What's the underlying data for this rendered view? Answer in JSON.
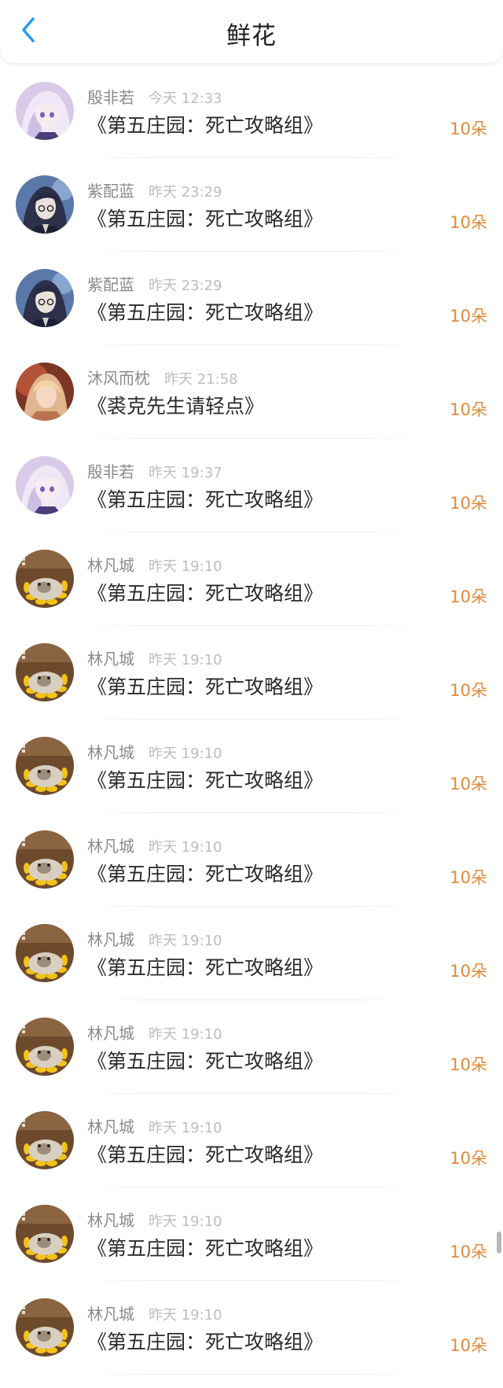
{
  "header": {
    "title": "鲜花"
  },
  "icons": {
    "back": "chevron-left-icon"
  },
  "colors": {
    "accent": "#2a9df4",
    "amount": "#e08a3a"
  },
  "items": [
    {
      "name": "殷非若",
      "time": "今天 12:33",
      "book": "《第五庄园：死亡攻略组》",
      "amount": "10朵",
      "avatar": "anime-girl-lavender"
    },
    {
      "name": "紫配蓝",
      "time": "昨天 23:29",
      "book": "《第五庄园：死亡攻略组》",
      "amount": "10朵",
      "avatar": "anime-boy-dark"
    },
    {
      "name": "紫配蓝",
      "time": "昨天 23:29",
      "book": "《第五庄园：死亡攻略组》",
      "amount": "10朵",
      "avatar": "anime-boy-dark"
    },
    {
      "name": "沐风而枕",
      "time": "昨天 21:58",
      "book": "《裘克先生请轻点》",
      "amount": "10朵",
      "avatar": "anime-warm"
    },
    {
      "name": "殷非若",
      "time": "昨天 19:37",
      "book": "《第五庄园：死亡攻略组》",
      "amount": "10朵",
      "avatar": "anime-girl-lavender"
    },
    {
      "name": "林凡城",
      "time": "昨天 19:10",
      "book": "《第五庄园：死亡攻略组》",
      "amount": "10朵",
      "avatar": "cat-sunflower"
    },
    {
      "name": "林凡城",
      "time": "昨天 19:10",
      "book": "《第五庄园：死亡攻略组》",
      "amount": "10朵",
      "avatar": "cat-sunflower"
    },
    {
      "name": "林凡城",
      "time": "昨天 19:10",
      "book": "《第五庄园：死亡攻略组》",
      "amount": "10朵",
      "avatar": "cat-sunflower"
    },
    {
      "name": "林凡城",
      "time": "昨天 19:10",
      "book": "《第五庄园：死亡攻略组》",
      "amount": "10朵",
      "avatar": "cat-sunflower"
    },
    {
      "name": "林凡城",
      "time": "昨天 19:10",
      "book": "《第五庄园：死亡攻略组》",
      "amount": "10朵",
      "avatar": "cat-sunflower"
    },
    {
      "name": "林凡城",
      "time": "昨天 19:10",
      "book": "《第五庄园：死亡攻略组》",
      "amount": "10朵",
      "avatar": "cat-sunflower"
    },
    {
      "name": "林凡城",
      "time": "昨天 19:10",
      "book": "《第五庄园：死亡攻略组》",
      "amount": "10朵",
      "avatar": "cat-sunflower"
    },
    {
      "name": "林凡城",
      "time": "昨天 19:10",
      "book": "《第五庄园：死亡攻略组》",
      "amount": "10朵",
      "avatar": "cat-sunflower"
    },
    {
      "name": "林凡城",
      "time": "昨天 19:10",
      "book": "《第五庄园：死亡攻略组》",
      "amount": "10朵",
      "avatar": "cat-sunflower"
    }
  ]
}
